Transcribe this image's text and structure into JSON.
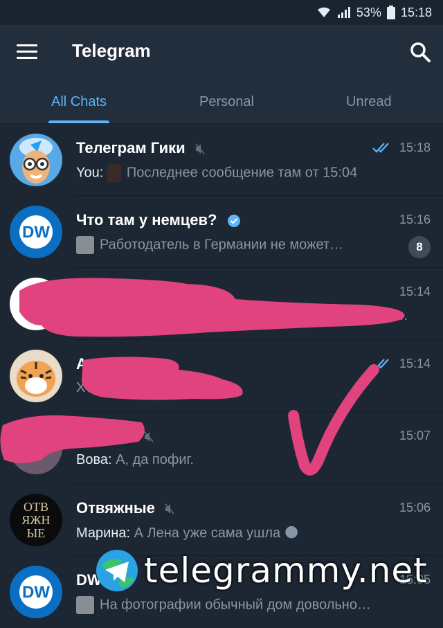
{
  "status_bar": {
    "battery_percent": "53%",
    "time": "15:18"
  },
  "header": {
    "title": "Telegram",
    "menu_icon": "hamburger-menu-icon",
    "search_icon": "search-icon"
  },
  "tabs": [
    {
      "label": "All Chats",
      "active": true
    },
    {
      "label": "Personal",
      "active": false
    },
    {
      "label": "Unread",
      "active": false
    }
  ],
  "chats": [
    {
      "name": "Телеграм Гики",
      "muted": true,
      "sender": "You:",
      "preview": "Последнее сообщение там от 15:04",
      "time": "15:18",
      "read_ticks": true,
      "avatar": "geek-cartoon-avatar"
    },
    {
      "name": "Что там у немцев?",
      "verified": true,
      "preview": "Работодатель в Германии не может…",
      "time": "15:16",
      "unread_count": "8",
      "avatar": "dw-logo-avatar"
    },
    {
      "name": "",
      "preview": "…",
      "time": "15:14",
      "avatar": "redacted-avatar"
    },
    {
      "name": "Ал",
      "preview": "Х",
      "time": "15:14",
      "read_ticks": true,
      "avatar": "tiger-avatar"
    },
    {
      "name": "",
      "muted": true,
      "sender": "Вова:",
      "preview": "А, да пофиг.",
      "time": "15:07",
      "avatar": "redacted-avatar"
    },
    {
      "name": "Отвяжные",
      "muted": true,
      "sender": "Марина:",
      "preview": "А Лена уже сама ушла 🌑",
      "time": "15:06",
      "avatar": "otvyazhnye-text-avatar"
    },
    {
      "name": "DW",
      "verified": true,
      "preview": "На фотографии обычный дом довольно…",
      "time": "15:05",
      "avatar": "dw-logo-avatar"
    }
  ],
  "watermark": {
    "text": "telegrammy.net",
    "icon": "telegram-globe-icon"
  },
  "avatar_texts": {
    "dw": "DW",
    "otvyazhnye_lines": [
      "ОТВ",
      "ЯЖН",
      "ЫЕ"
    ]
  },
  "colors": {
    "background": "#1d2733",
    "header": "#232e3c",
    "accent": "#5eb5f7",
    "scribble": "#e0437e"
  }
}
